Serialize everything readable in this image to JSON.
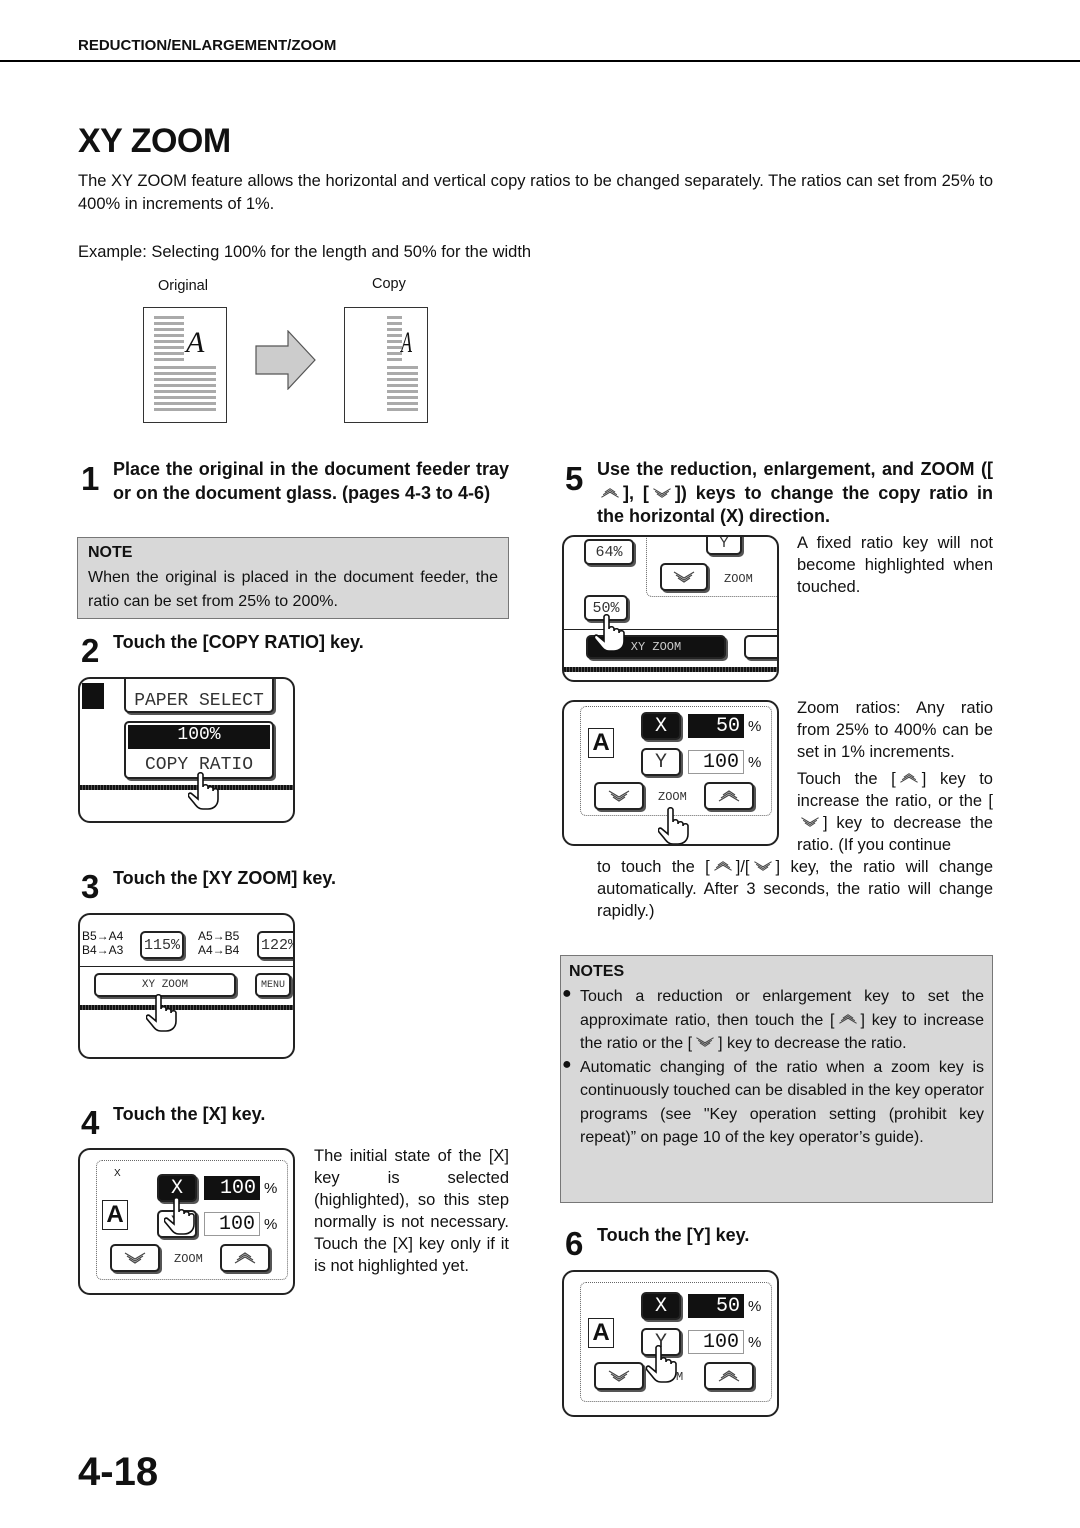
{
  "header": {
    "section": "REDUCTION/ENLARGEMENT/ZOOM",
    "title": "XY ZOOM"
  },
  "intro": "The XY ZOOM feature allows the horizontal and vertical copy ratios to be changed separately. The ratios can set from 25% to 400% in increments of 1%.",
  "example": {
    "text": "Example: Selecting 100% for the length and 50% for the width",
    "original_label": "Original",
    "copy_label": "Copy",
    "glyph": "A"
  },
  "steps": [
    {
      "num": "1",
      "text": "Place the original in the document feeder tray or on the document glass. (pages 4-3 to 4-6)"
    },
    {
      "num": "2",
      "text": "Touch the [COPY RATIO] key."
    },
    {
      "num": "3",
      "text": "Touch the [XY ZOOM] key."
    },
    {
      "num": "4",
      "text": "Touch the [X] key."
    },
    {
      "num": "5",
      "text_a": "Use the reduction, enlargement, and ZOOM ([",
      "text_b": "], [",
      "text_c": "]) keys to change the copy ratio in the horizontal (X) direction."
    },
    {
      "num": "6",
      "text": "Touch the [Y] key."
    }
  ],
  "note": {
    "heading": "NOTE",
    "text": "When the original is placed in the document feeder, the ratio can be set from 25% to 200%."
  },
  "panel2": {
    "paper_select": "PAPER SELECT",
    "ratio": "100%",
    "copy_ratio": "COPY RATIO"
  },
  "panel3": {
    "row1a": "B5→A4",
    "row1b": "B4→A3",
    "key1": "115%",
    "row2a": "A5→B5",
    "row2b": "A4→B4",
    "key2": "122%",
    "xy_zoom": "XY ZOOM",
    "menu": "MENU"
  },
  "panel4": {
    "x": "X",
    "y": "Y",
    "x_val": "100",
    "y_val": "100",
    "pct": "%",
    "zoom": "ZOOM",
    "x_axis": "X",
    "y_axis": "Y",
    "glyph": "A"
  },
  "step4_text": "The initial state of the [X] key is selected (highlighted), so this step normally is not necessary. Touch the [X] key only if it is not highlighted yet.",
  "panel5a": {
    "r1": "64%",
    "r2": "50%",
    "y": "Y",
    "zoom": "ZOOM",
    "xy_zoom": "XY ZOOM"
  },
  "step5_text1": "A fixed ratio key will not become highlighted when touched.",
  "panel5b": {
    "x": "X",
    "y": "Y",
    "x_val": "50",
    "y_val": "100",
    "pct": "%",
    "zoom": "ZOOM",
    "glyph": "A"
  },
  "step5_text2a": "Zoom ratios: Any ratio from 25% to 400% can be set in 1% increments.",
  "step5_text2b_1": "Touch the [",
  "step5_text2b_2": "] key to increase the ratio, or the [",
  "step5_text2b_3": "] key to decrease the ratio. (If you continue",
  "step5_text2c_1": "to touch the [",
  "step5_text2c_2": "]/[",
  "step5_text2c_3": "] key, the ratio will change automatically. After 3 seconds, the ratio will change rapidly.)",
  "notes": {
    "heading": "NOTES",
    "item1_a": "Touch a reduction or enlargement key to set the approximate ratio, then touch the [",
    "item1_b": "] key to increase the ratio or the [",
    "item1_c": "] key to decrease the ratio.",
    "item2": "Automatic changing of the ratio when a zoom key is continuously touched can be disabled in the key operator programs (see \"Key operation setting (prohibit key repeat)” on page 10 of the key operator’s guide)."
  },
  "panel6": {
    "x": "X",
    "y": "Y",
    "x_val": "50",
    "y_val": "100",
    "pct": "%",
    "zoom": "M",
    "glyph": "A"
  },
  "page_number": "4-18",
  "icons": {
    "up": "zoom-up-chevrons-icon",
    "down": "zoom-down-chevrons-icon",
    "hand": "touch-hand-icon"
  }
}
